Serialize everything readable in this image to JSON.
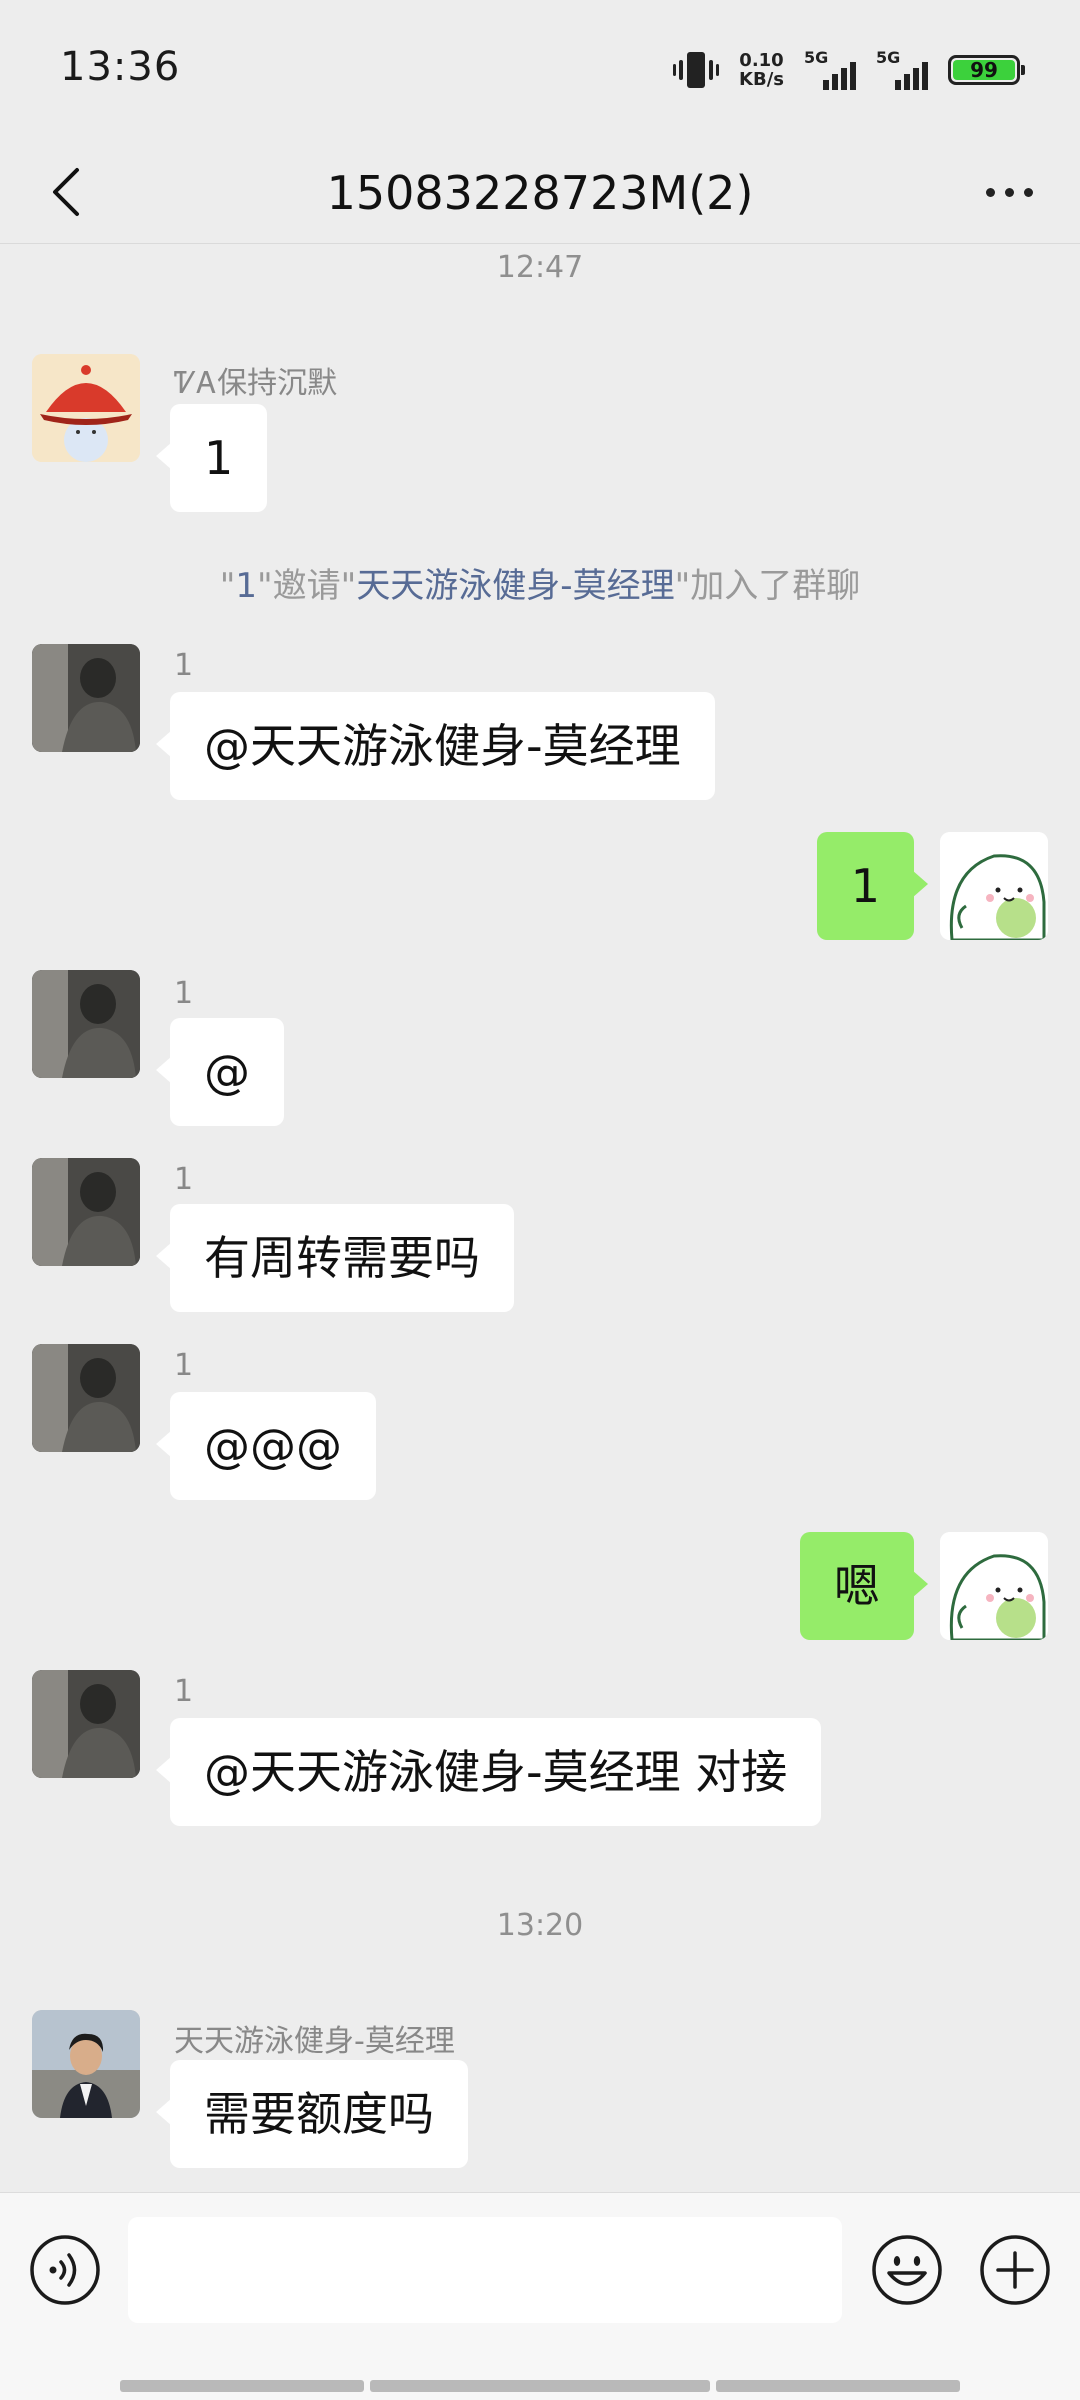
{
  "status": {
    "time": "13:36",
    "net_speed_value": "0.10",
    "net_speed_unit": "KB/s",
    "sim1": "5G",
    "sim2": "5G",
    "battery": "99"
  },
  "header": {
    "title": "15083228723M(2)"
  },
  "messages": {
    "ts1": "12:47",
    "m1": {
      "sender": "ᏤᎪ保持沉默",
      "text": "1"
    },
    "sys": {
      "q1": "\"",
      "inviter": "1",
      "mid": "\"邀请\"",
      "invitee": "天天游泳健身-莫经理",
      "end": "\"加入了群聊"
    },
    "m2": {
      "sender": "1",
      "text": "@天天游泳健身-莫经理"
    },
    "m3": {
      "text": "1"
    },
    "m4": {
      "sender": "1",
      "text": "@"
    },
    "m5": {
      "sender": "1",
      "text": "有周转需要吗"
    },
    "m6": {
      "sender": "1",
      "text": "@@@"
    },
    "m7": {
      "text": "嗯"
    },
    "m8": {
      "sender": "1",
      "text": "@天天游泳健身-莫经理  对接"
    },
    "ts2": "13:20",
    "m9": {
      "sender": "天天游泳健身-莫经理",
      "text": "需要额度吗"
    }
  },
  "input": {
    "value": "",
    "voice_icon": "voice-icon",
    "emoji_icon": "emoji-icon",
    "plus_icon": "plus-icon"
  },
  "colors": {
    "background": "#ededed",
    "outgoing_bubble": "#95ec69",
    "incoming_bubble": "#ffffff",
    "link": "#576b95",
    "battery": "#3cd13c"
  }
}
